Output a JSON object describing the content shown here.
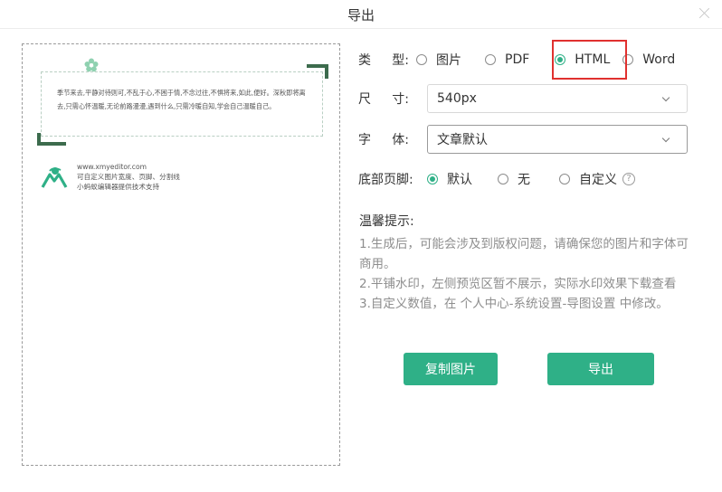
{
  "dialog": {
    "title": "导出"
  },
  "preview": {
    "card_text": "季节来去,平静对待则可,不乱于心,不困于情,不念过往,不惧将来,如此,便好。深秋即将离去,只需心怀温暖,无论前路漫漫,遇到什么,只需冷暖自知,学会自己温暖自己。",
    "brand_url": "www.xmyeditor.com",
    "brand_line1": "可自定义图片宽度、页脚、分割线",
    "brand_line2": "小蚂蚁编辑器提供技术支持"
  },
  "form": {
    "type": {
      "label_a": "类",
      "label_b": "型:",
      "options": [
        "图片",
        "PDF",
        "HTML",
        "Word"
      ],
      "selected": "HTML"
    },
    "size": {
      "label_a": "尺",
      "label_b": "寸:",
      "value": "540px"
    },
    "font": {
      "label_a": "字",
      "label_b": "体:",
      "value": "文章默认"
    },
    "footer": {
      "label": "底部页脚:",
      "options": [
        "默认",
        "无",
        "自定义"
      ],
      "selected": "默认",
      "help": "?"
    }
  },
  "tips": {
    "title": "温馨提示:",
    "line1": "1.生成后，可能会涉及到版权问题，请确保您的图片和字体可商用。",
    "line2": "2.平铺水印，左侧预览区暂不展示，实际水印效果下载查看",
    "line3": "3.自定义数值，在 个人中心-系统设置-导图设置 中修改。"
  },
  "actions": {
    "copy": "复制图片",
    "export": "导出"
  },
  "colors": {
    "accent": "#2fb087",
    "highlight": "#e0312f",
    "frame": "#3c6b4d"
  },
  "icons": {
    "close": "close-icon",
    "help": "help-icon",
    "flower": "flower-icon",
    "logo": "brand-logo-icon",
    "chevron": "chevron-down-icon"
  }
}
